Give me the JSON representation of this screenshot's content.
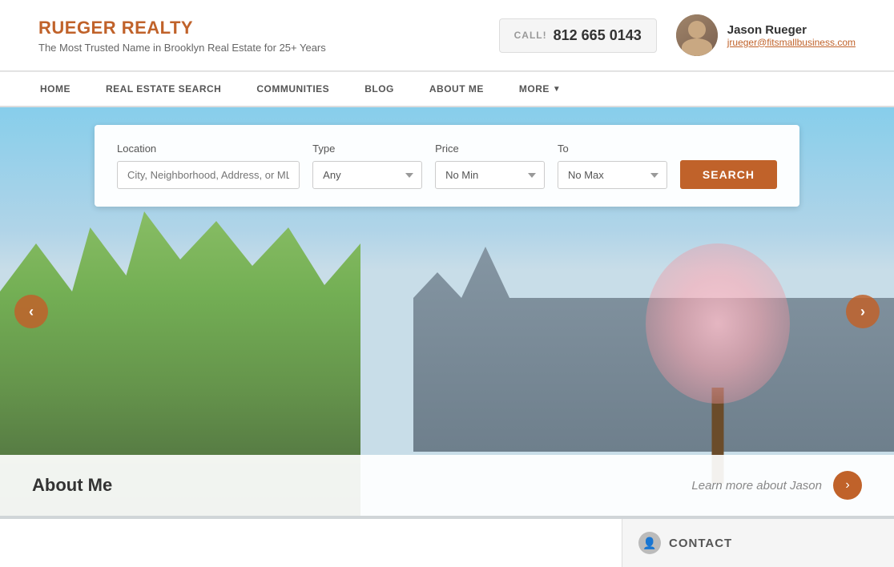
{
  "brand": {
    "name": "RUEGER REALTY",
    "tagline": "The Most Trusted Name in Brooklyn Real Estate for 25+ Years"
  },
  "header": {
    "call_label": "CALL!",
    "phone": "812 665 0143",
    "agent_name": "Jason Rueger",
    "agent_email": "jrueger@fitsmallbusiness.com"
  },
  "nav": {
    "items": [
      {
        "label": "HOME"
      },
      {
        "label": "REAL ESTATE SEARCH"
      },
      {
        "label": "COMMUNITIES"
      },
      {
        "label": "BLOG"
      },
      {
        "label": "ABOUT ME"
      },
      {
        "label": "MORE"
      }
    ]
  },
  "search": {
    "location_label": "Location",
    "location_placeholder": "City, Neighborhood, Address, or MLS#",
    "type_label": "Type",
    "type_default": "Any",
    "price_label": "Price",
    "price_default": "No Min",
    "to_label": "To",
    "to_default": "No Max",
    "button_label": "SEARCH"
  },
  "carousel": {
    "prev_icon": "‹",
    "next_icon": "›"
  },
  "about_banner": {
    "title": "About Me",
    "link_text": "Learn more about Jason",
    "arrow_icon": "›"
  },
  "bottom": {
    "contact_title": "CONTACT"
  }
}
